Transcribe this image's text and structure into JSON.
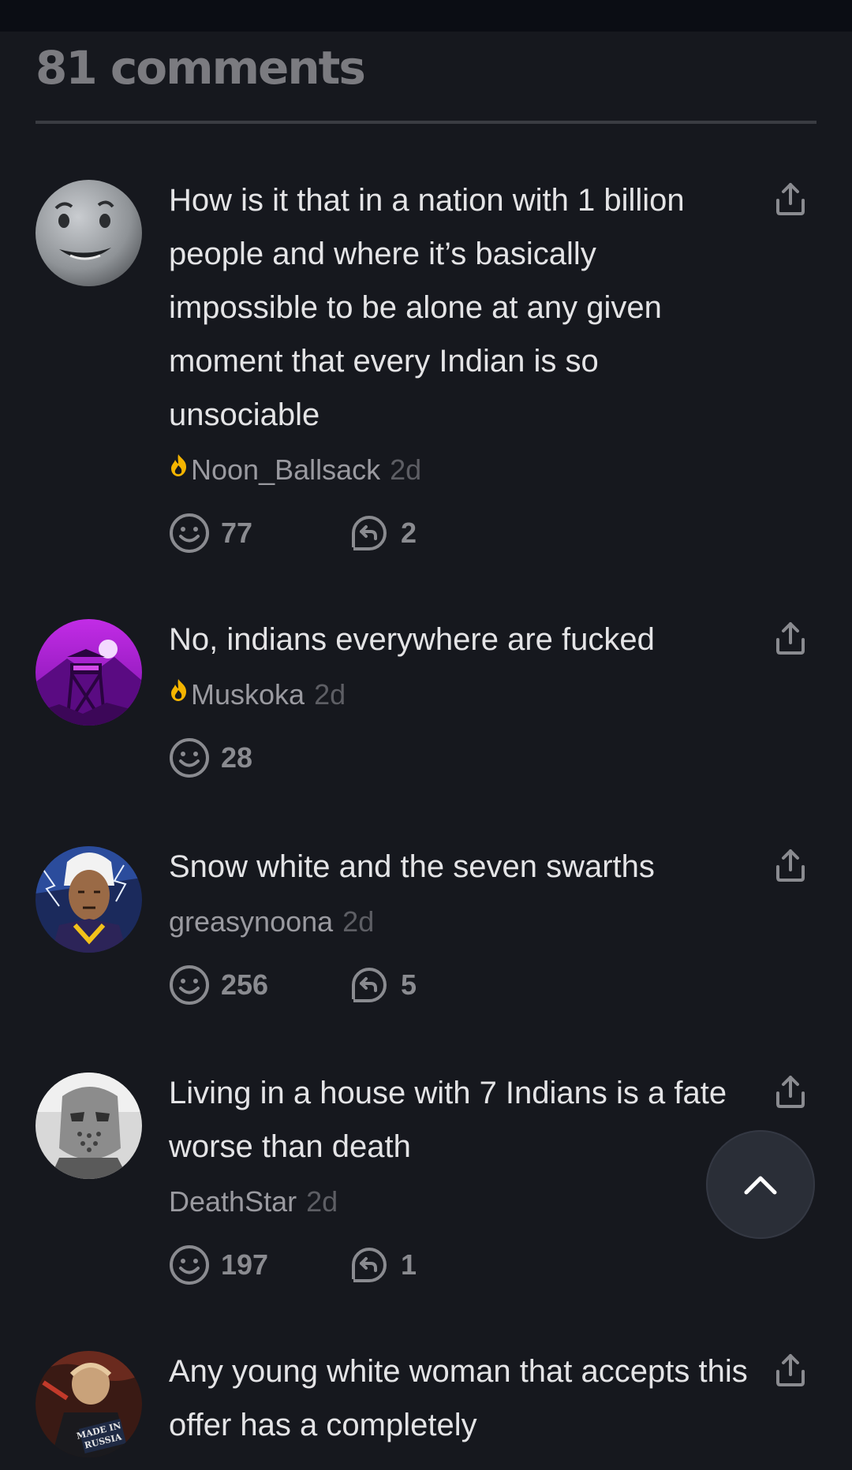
{
  "header": {
    "title": "81 comments"
  },
  "comments": [
    {
      "text": "How is it that in a nation with 1 billion people and where it’s basically impossible to be alone at any given moment that every Indian is so unsociable",
      "username": "Noon_Ballsack",
      "age": "2d",
      "has_flame_badge": true,
      "reactions": "77",
      "replies": "2",
      "avatar_icon": "smiling-moon-avatar"
    },
    {
      "text": "No, indians everywhere are fucked",
      "username": "Muskoka",
      "age": "2d",
      "has_flame_badge": true,
      "reactions": "28",
      "replies": null,
      "avatar_icon": "purple-watchtower-avatar"
    },
    {
      "text": "Snow white and the seven swarths",
      "username": "greasynoona",
      "age": "2d",
      "has_flame_badge": false,
      "reactions": "256",
      "replies": "5",
      "avatar_icon": "anime-character-avatar"
    },
    {
      "text": "Living in a house with 7 Indians is a fate worse than death",
      "username": "DeathStar",
      "age": "2d",
      "has_flame_badge": false,
      "reactions": "197",
      "replies": "1",
      "avatar_icon": "hockey-mask-avatar"
    },
    {
      "text": "Any young white woman that accepts this offer has a completely",
      "username": "",
      "age": "",
      "has_flame_badge": false,
      "reactions": null,
      "replies": null,
      "avatar_icon": "made-in-russia-avatar",
      "avatar_text": "MADE IN RUSSIA"
    }
  ],
  "colors": {
    "background": "#16181e",
    "flame_badge": "#f4b400",
    "text_primary": "#e4e4e6",
    "text_muted": "#9a9aa0"
  }
}
